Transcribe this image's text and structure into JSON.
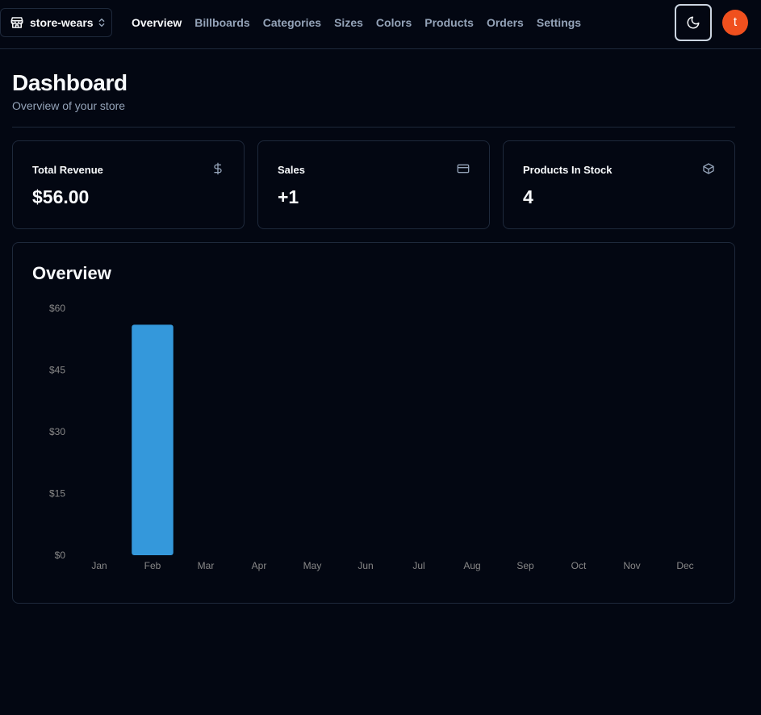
{
  "header": {
    "store_name": "store-wears",
    "store_icon": "store-icon",
    "switcher_icon": "chevrons-up-down-icon",
    "nav": [
      {
        "label": "Overview",
        "active": true
      },
      {
        "label": "Billboards",
        "active": false
      },
      {
        "label": "Categories",
        "active": false
      },
      {
        "label": "Sizes",
        "active": false
      },
      {
        "label": "Colors",
        "active": false
      },
      {
        "label": "Products",
        "active": false
      },
      {
        "label": "Orders",
        "active": false
      },
      {
        "label": "Settings",
        "active": false
      }
    ],
    "theme_icon": "moon-icon",
    "avatar_letter": "t",
    "avatar_color": "#f0501e"
  },
  "page": {
    "title": "Dashboard",
    "subtitle": "Overview of your store"
  },
  "cards": [
    {
      "label": "Total Revenue",
      "value": "$56.00",
      "icon": "dollar-icon"
    },
    {
      "label": "Sales",
      "value": "+1",
      "icon": "credit-card-icon"
    },
    {
      "label": "Products In Stock",
      "value": "4",
      "icon": "package-icon"
    }
  ],
  "chart": {
    "title": "Overview"
  },
  "chart_data": {
    "type": "bar",
    "categories": [
      "Jan",
      "Feb",
      "Mar",
      "Apr",
      "May",
      "Jun",
      "Jul",
      "Aug",
      "Sep",
      "Oct",
      "Nov",
      "Dec"
    ],
    "values": [
      0,
      56,
      0,
      0,
      0,
      0,
      0,
      0,
      0,
      0,
      0,
      0
    ],
    "ylim": [
      0,
      60
    ],
    "yticks": [
      0,
      15,
      30,
      45,
      60
    ],
    "ytick_labels": [
      "$0",
      "$15",
      "$30",
      "$45",
      "$60"
    ],
    "bar_color": "#3498db",
    "grid": false
  },
  "colors": {
    "background": "#030712",
    "border": "#1e293b",
    "muted_text": "#94a3b8"
  }
}
